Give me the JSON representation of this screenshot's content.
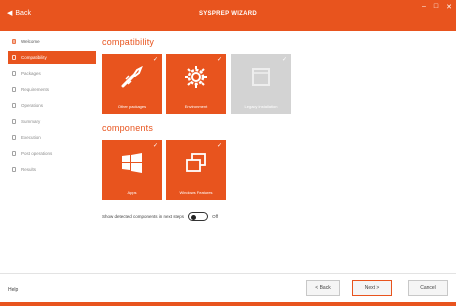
{
  "window": {
    "back_label": "Back",
    "title": "SYSPREP WIZARD",
    "controls": [
      "–",
      "□",
      "✕"
    ]
  },
  "sidebar": {
    "items": [
      {
        "label": "Welcome",
        "state": "done"
      },
      {
        "label": "Compatibility",
        "state": "active"
      },
      {
        "label": "Packages",
        "state": "pending"
      },
      {
        "label": "Requirements",
        "state": "pending"
      },
      {
        "label": "Operations",
        "state": "pending"
      },
      {
        "label": "Summary",
        "state": "pending"
      },
      {
        "label": "Execution",
        "state": "pending"
      },
      {
        "label": "Post operations",
        "state": "pending"
      },
      {
        "label": "Results",
        "state": "pending"
      }
    ]
  },
  "sections": {
    "compatibility_title": "compatibility",
    "components_title": "components"
  },
  "tiles_row1": [
    {
      "label": "Other packages",
      "icon": "wrench-icon",
      "checked": true,
      "enabled": true
    },
    {
      "label": "Environment",
      "icon": "gear-icon",
      "checked": true,
      "enabled": true
    },
    {
      "label": "Legacy installation",
      "icon": "window-icon",
      "checked": true,
      "enabled": false
    }
  ],
  "tiles_row2": [
    {
      "label": "Apps",
      "icon": "windows-logo-icon",
      "checked": true,
      "enabled": true
    },
    {
      "label": "Windows Features",
      "icon": "windows-overlap-icon",
      "checked": true,
      "enabled": true
    }
  ],
  "toggle": {
    "label": "Show detected components in next steps",
    "state": "Off"
  },
  "footer": {
    "help": "Help",
    "back": "< Back",
    "next": "Next >",
    "cancel": "Cancel"
  },
  "colors": {
    "accent": "#e8541e",
    "disabled_tile": "#d3d3d3"
  }
}
